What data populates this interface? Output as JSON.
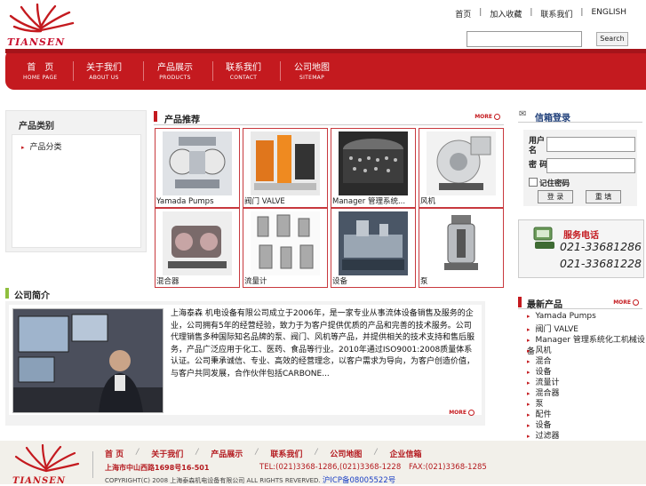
{
  "header": {
    "logo_text": "TIANSEN",
    "top_links": [
      "首页",
      "加入收藏",
      "联系我们",
      "ENGLISH"
    ],
    "search_placeholder": "",
    "search_button": "Search"
  },
  "nav": [
    {
      "cn": "首　页",
      "en": "HOME PAGE"
    },
    {
      "cn": "关于我们",
      "en": "ABOUT US"
    },
    {
      "cn": "产品展示",
      "en": "PRODUCTS"
    },
    {
      "cn": "联系我们",
      "en": "CONTACT"
    },
    {
      "cn": "公司地图",
      "en": "SITEMAP"
    }
  ],
  "sidebar": {
    "title": "产品类别",
    "items": [
      "产品分类"
    ]
  },
  "products": {
    "title": "产品推荐",
    "more": "MORE",
    "items": [
      {
        "caption": "Yamada Pumps"
      },
      {
        "caption": "阀门 VALVE"
      },
      {
        "caption": "Manager 管理系统..."
      },
      {
        "caption": "风机"
      },
      {
        "caption": "混合器"
      },
      {
        "caption": "流量计"
      },
      {
        "caption": "设备"
      },
      {
        "caption": "泵"
      }
    ]
  },
  "intro": {
    "title": "公司简介",
    "text": "上海泰森 机电设备有限公司成立于2006年，是一家专业从事流体设备销售及服务的企业，公司拥有5年的经营经验，致力于为客户提供优质的产品和完善的技术服务。公司代理销售多种国际知名品牌的泵、阀门、风机等产品，并提供相关的技术支持和售后服务，产品广泛应用于化工、医药、食品等行业。2010年通过ISO9001:2008质量体系认证。公司秉承诚信、专业、高效的经营理念，以客户需求为导向，为客户创造价值，与客户共同发展，合作伙伴包括CARBONE...",
    "more": "MORE"
  },
  "mail": {
    "title": "信箱登录",
    "user_label": "用户名",
    "pass_label": "密 码",
    "remember_label": "记住密码",
    "login_button": "登 录",
    "reset_button": "重 填"
  },
  "service": {
    "title": "服务电话",
    "phone1": "021-33681286",
    "phone2": "021-33681228"
  },
  "new_products": {
    "title": "最新产品",
    "more": "MORE",
    "items": [
      "Yamada Pumps",
      "阀门 VALVE",
      "Manager 管理系统化工机械设备",
      "风机",
      "混合",
      "设备",
      "流量计",
      "混合器",
      "泵",
      "配件",
      "设备",
      "过滤器"
    ]
  },
  "footer": {
    "nav": [
      "首 页",
      "关于我们",
      "产品展示",
      "联系我们",
      "公司地图",
      "企业信箱"
    ],
    "address": "上海市中山西路1698号16-501",
    "tel": "TEL:(021)3368-1286,(021)3368-1228",
    "fax": "FAX:(021)3368-1285",
    "copyright": "COPYRIGHT(C) 2008 上海泰森机电设备有限公司 ALL RIGHTS REVERVED.",
    "icp": "沪ICP备08005522号"
  },
  "colors": {
    "brand_red": "#c41a1f",
    "panel_gray": "#f2f2f2"
  }
}
